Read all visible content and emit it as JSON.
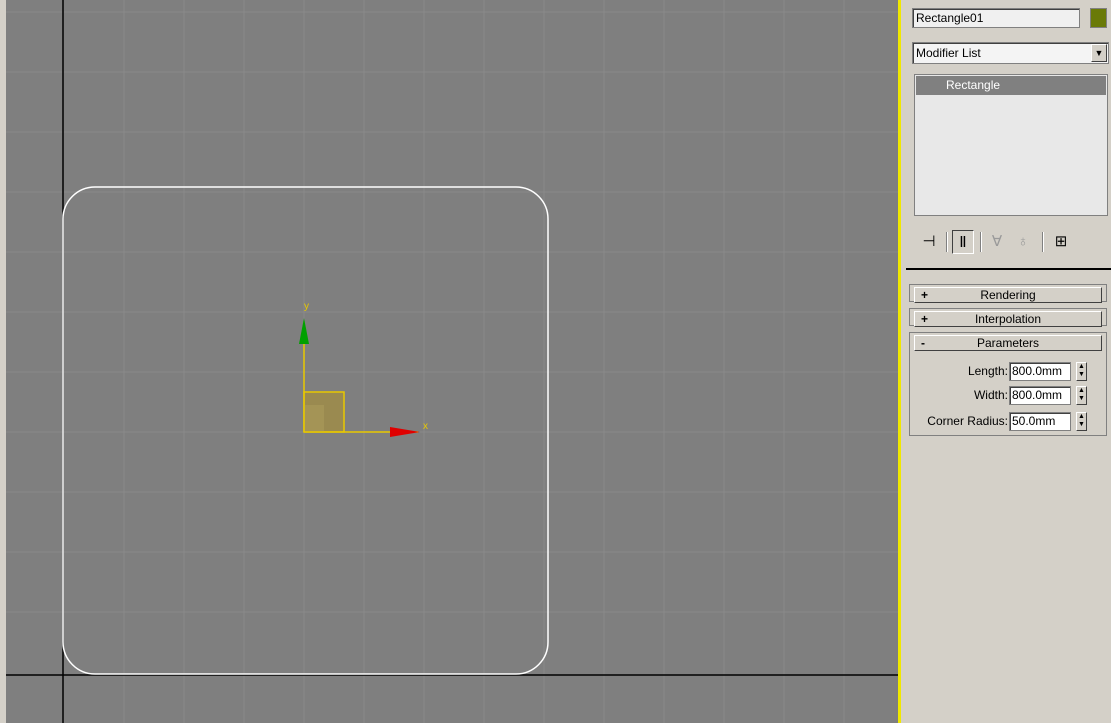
{
  "viewport": {
    "axis_x_label": "x",
    "axis_y_label": "y",
    "colors": {
      "background": "#7f7f7f",
      "grid": "#8a8a8a",
      "shape": "#ffffff",
      "gizmo": "#e8c800",
      "x_axis": "#e00000",
      "y_axis": "#00a000"
    }
  },
  "command_panel": {
    "object_name": "Rectangle01",
    "object_color": "#6a7a08",
    "modifier_list": "Modifier List",
    "stack": {
      "items": [
        "Rectangle"
      ],
      "selected": "Rectangle"
    },
    "toolbar_icons": [
      "pin-stack-icon",
      "show-end-result-icon",
      "make-unique-icon",
      "remove-modifier-icon",
      "configure-modifier-sets-icon"
    ],
    "rollouts": [
      {
        "sign": "+",
        "title": "Rendering"
      },
      {
        "sign": "+",
        "title": "Interpolation"
      },
      {
        "sign": "-",
        "title": "Parameters"
      }
    ],
    "parameters": {
      "length_label": "Length:",
      "length_value": "800.0mm",
      "width_label": "Width:",
      "width_value": "800.0mm",
      "corner_radius_label": "Corner Radius:",
      "corner_radius_value": "50.0mm"
    }
  }
}
